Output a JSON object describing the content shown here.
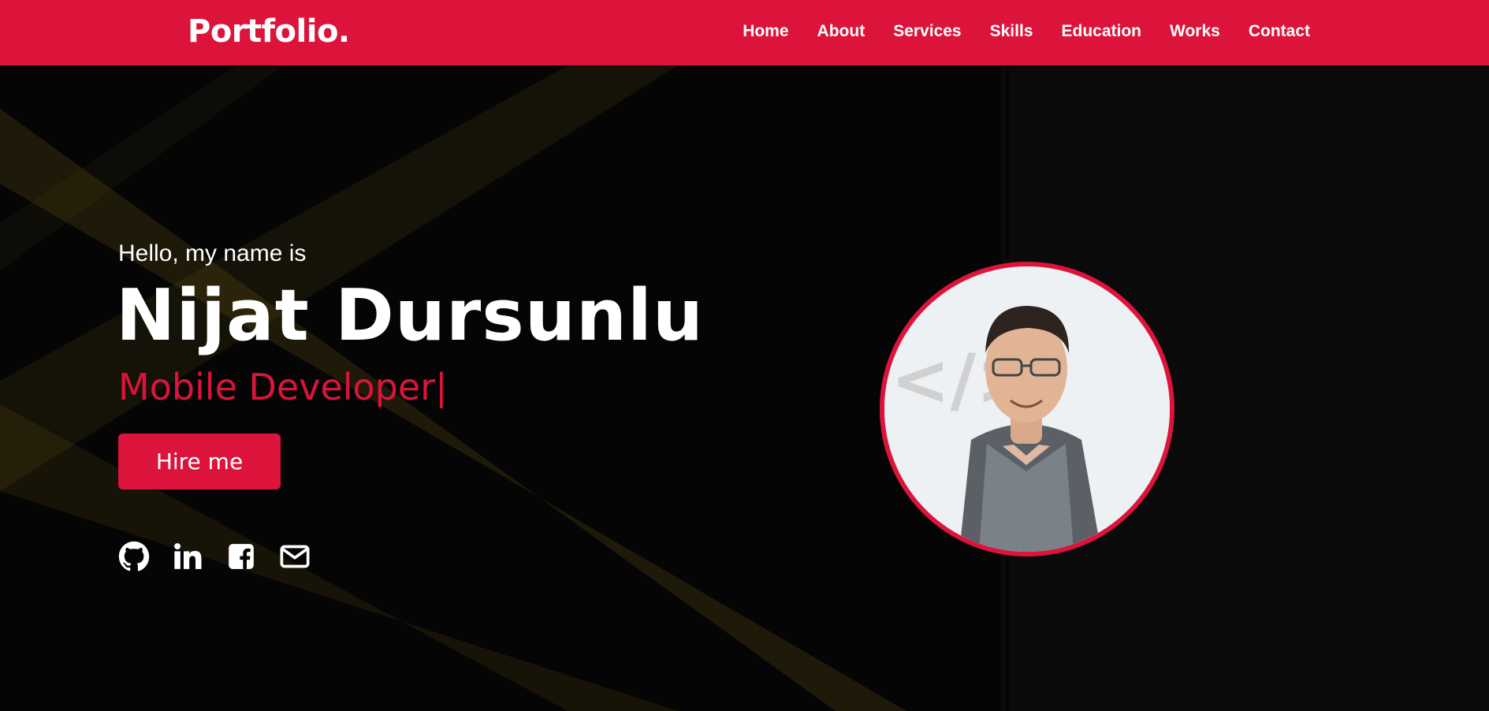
{
  "navbar": {
    "logo": "Portfolio.",
    "menu": [
      "Home",
      "About",
      "Services",
      "Skills",
      "Education",
      "Works",
      "Contact"
    ]
  },
  "hero": {
    "greeting": "Hello, my name is",
    "name": "Nijat Dursunlu",
    "role": "Mobile Developer",
    "cursor": "|",
    "cta_label": "Hire me"
  },
  "socials": [
    {
      "icon": "github-icon"
    },
    {
      "icon": "linkedin-icon"
    },
    {
      "icon": "facebook-icon"
    },
    {
      "icon": "envelope-icon"
    }
  ],
  "colors": {
    "accent": "#dc143c",
    "background": "#050505",
    "text": "#ffffff"
  }
}
